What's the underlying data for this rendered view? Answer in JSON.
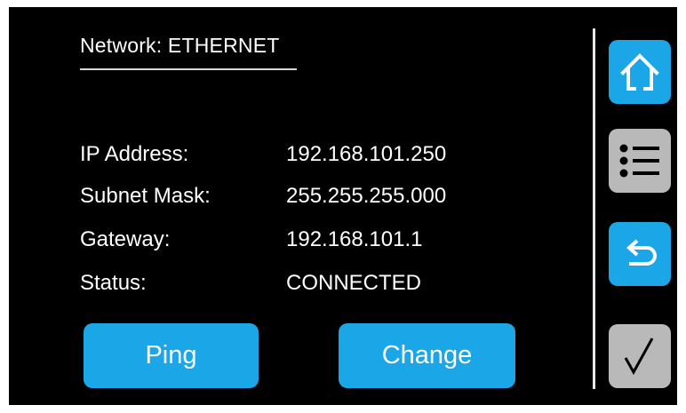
{
  "header": {
    "title": "Network: ETHERNET"
  },
  "info": [
    {
      "label": "IP Address:",
      "value": "192.168.101.250"
    },
    {
      "label": "Subnet Mask:",
      "value": "255.255.255.000"
    },
    {
      "label": "Gateway:",
      "value": "192.168.101.1"
    },
    {
      "label": "Status:",
      "value": "CONNECTED"
    }
  ],
  "actions": {
    "ping_label": "Ping",
    "change_label": "Change"
  },
  "sidebar": {
    "buttons": [
      {
        "icon": "home-icon",
        "color": "#1ba6e8"
      },
      {
        "icon": "menu-list-icon",
        "color": "#b9b9b9"
      },
      {
        "icon": "back-arrow-icon",
        "color": "#1ba6e8"
      },
      {
        "icon": "checkmark-icon",
        "color": "#b9b9b9"
      }
    ]
  },
  "colors": {
    "background": "#000000",
    "accent": "#1ba6e8",
    "disabled": "#b9b9b9",
    "text": "#ffffff"
  }
}
